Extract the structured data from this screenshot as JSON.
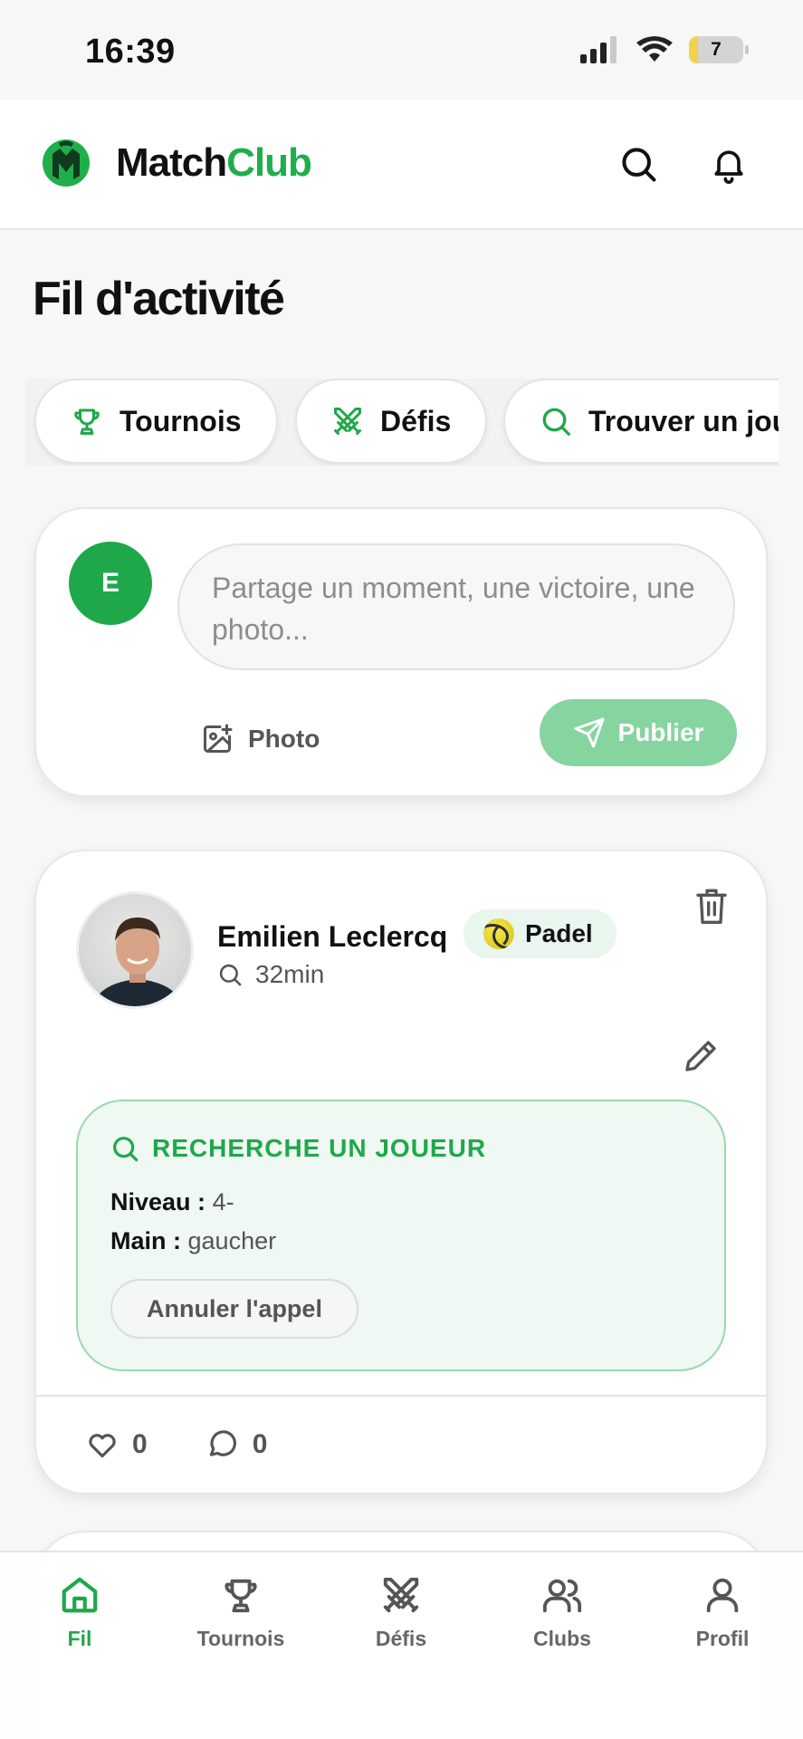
{
  "status_bar": {
    "time": "16:39",
    "battery": "7"
  },
  "app": {
    "brand_part1": "Match",
    "brand_part2": "Club"
  },
  "page": {
    "title": "Fil d'activité"
  },
  "chips": [
    {
      "label": "Tournois",
      "icon": "trophy-icon"
    },
    {
      "label": "Défis",
      "icon": "swords-icon"
    },
    {
      "label": "Trouver un jou",
      "icon": "search-icon"
    }
  ],
  "composer": {
    "avatar_initial": "E",
    "placeholder": "Partage un moment, une victoire, une photo...",
    "photo_label": "Photo",
    "publish_label": "Publier"
  },
  "post": {
    "author": "Emilien Leclercq",
    "sport": "Padel",
    "time": "32min",
    "search_title": "RECHERCHE UN JOUEUR",
    "level_label": "Niveau :",
    "level_value": "4-",
    "hand_label": "Main :",
    "hand_value": "gaucher",
    "cancel_label": "Annuler l'appel",
    "likes": "0",
    "comments": "0"
  },
  "tabbar": {
    "items": [
      {
        "label": "Fil",
        "active": true
      },
      {
        "label": "Tournois",
        "active": false
      },
      {
        "label": "Défis",
        "active": false
      },
      {
        "label": "Clubs",
        "active": false
      },
      {
        "label": "Profil",
        "active": false
      }
    ]
  },
  "colors": {
    "accent": "#1fa84a",
    "accent_light": "#86d4a0",
    "background": "#f6f7f6"
  }
}
